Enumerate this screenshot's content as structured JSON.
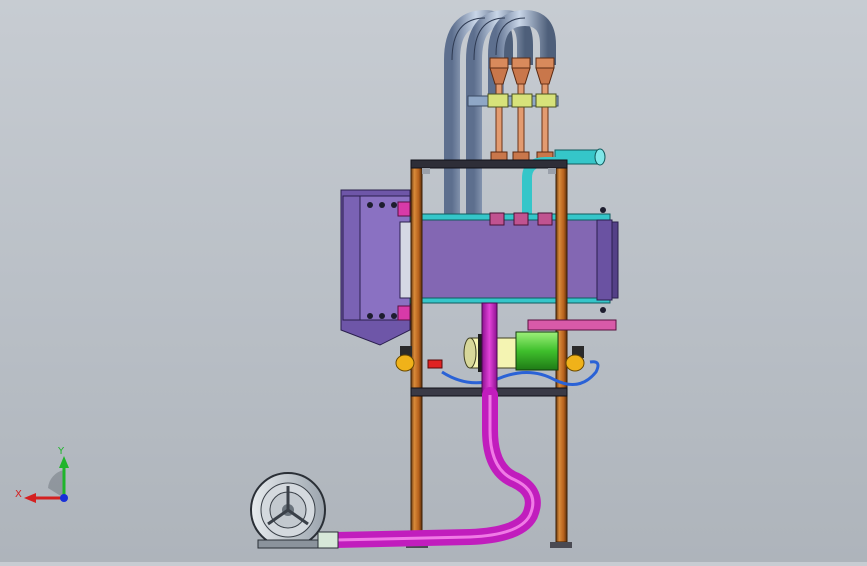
{
  "viewport": {
    "background_top": "#c7ccd2",
    "background_bottom": "#aeb4bb"
  },
  "triad": {
    "x_label": "X",
    "y_label": "Y",
    "x_color": "#d42020",
    "y_color": "#1fb52b",
    "z_color": "#1830d8"
  },
  "model": {
    "frame_color": "#b6611c",
    "housing_color": "#8367b3",
    "hose_color": "#c11dbd",
    "pipe_color": "#8fa7c6",
    "motor_color": "#4fd23a",
    "bracket_color": "#f0b219",
    "cable_color": "#2a62d6",
    "accent_cyan": "#35c6c9",
    "copper_color": "#c9774b"
  }
}
